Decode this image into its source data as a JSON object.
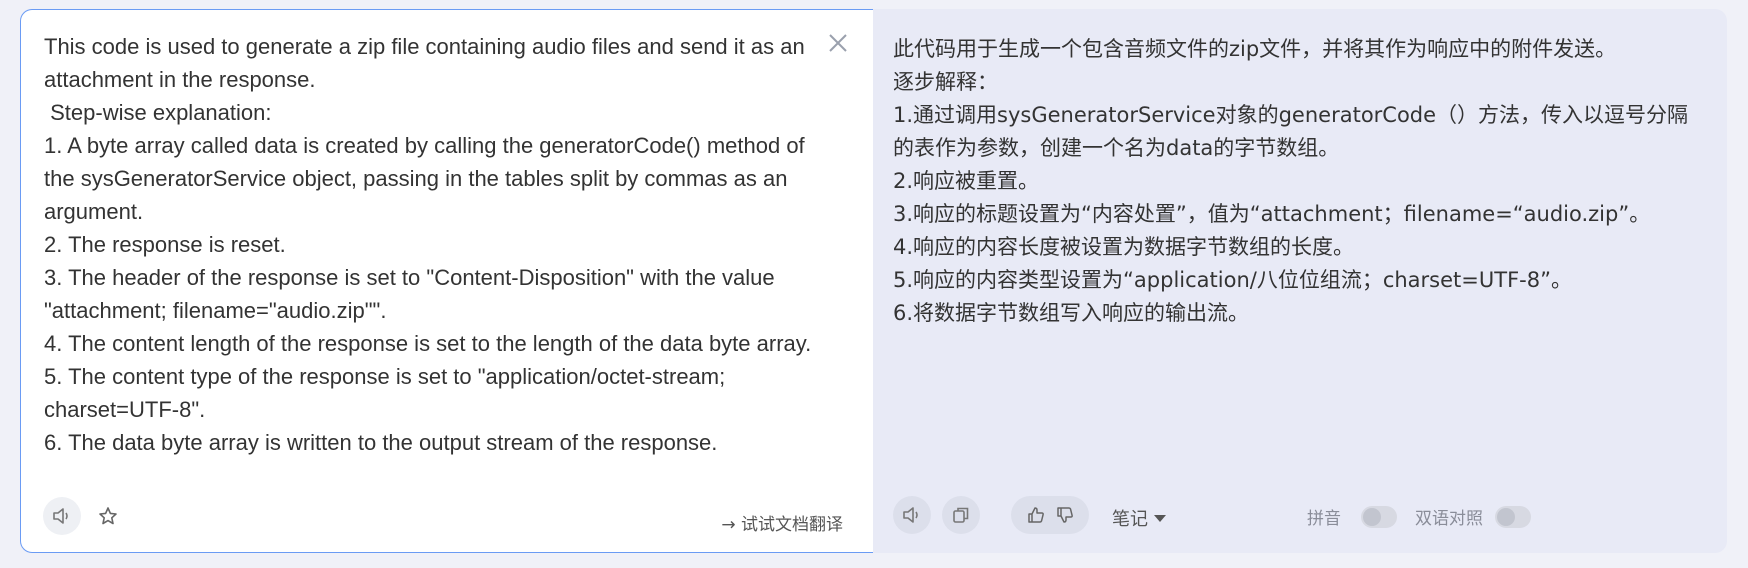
{
  "source": {
    "text": "This code is used to generate a zip file containing audio files and send it as an attachment in the response.\n Step-wise explanation:\n1. A byte array called data is created by calling the generatorCode() method of the sysGeneratorService object, passing in the tables split by commas as an argument.\n2. The response is reset.\n3. The header of the response is set to \"Content-Disposition\" with the value \"attachment; filename=\"audio.zip\"\".\n4. The content length of the response is set to the length of the data byte array.\n5. The content type of the response is set to \"application/octet-stream; charset=UTF-8\".\n6. The data byte array is written to the output stream of the response.",
    "doc_translate_link": "→ 试试文档翻译"
  },
  "target": {
    "text": "此代码用于生成一个包含音频文件的zip文件，并将其作为响应中的附件发送。\n逐步解释：\n1.通过调用sysGeneratorService对象的generatorCode（）方法，传入以逗号分隔的表作为参数，创建一个名为data的字节数组。\n2.响应被重置。\n3.响应的标题设置为“内容处置”，值为“attachment；filename=“audio.zip”。\n4.响应的内容长度被设置为数据字节数组的长度。\n5.响应的内容类型设置为“application/八位位组流；charset=UTF-8”。\n6.将数据字节数组写入响应的输出流。",
    "notes_label": "笔记",
    "pinyin_label": "拼音",
    "bilingual_label": "双语对照"
  },
  "icons": {
    "close": "close-icon",
    "speaker": "speaker-icon",
    "star": "star-icon",
    "copy": "copy-icon",
    "thumbs_up": "thumbs-up-icon",
    "thumbs_down": "thumbs-down-icon"
  },
  "colors": {
    "accent_border": "#6a9bf4",
    "right_panel_bg": "#e8eaf6"
  },
  "toggles": {
    "pinyin_on": false,
    "bilingual_on": false
  }
}
